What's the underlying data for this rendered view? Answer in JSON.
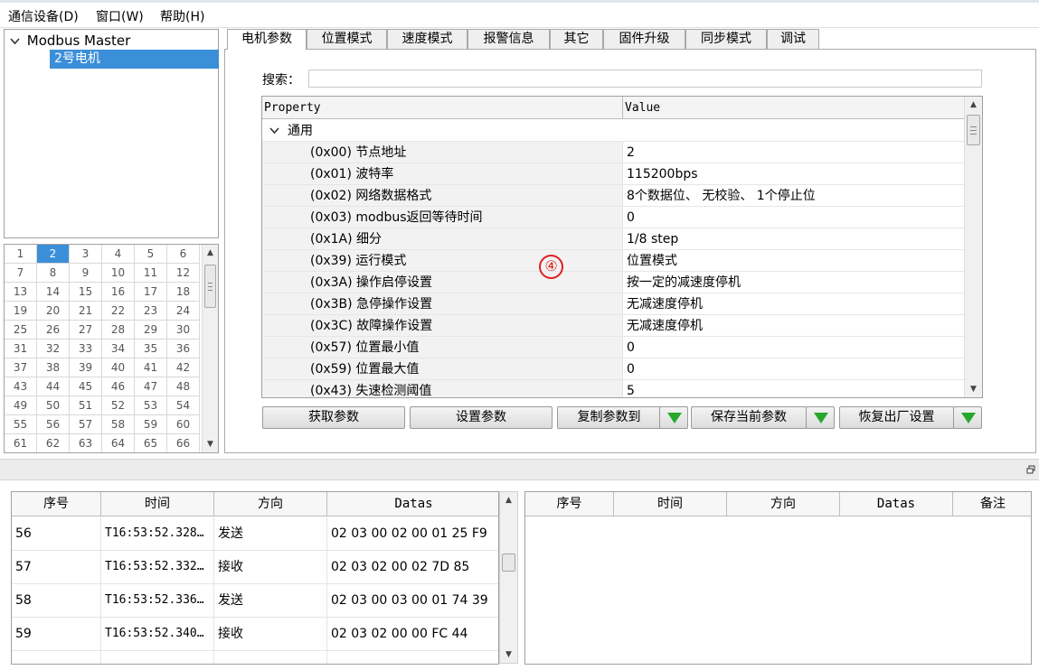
{
  "menu": [
    {
      "label": "通信设备(D)"
    },
    {
      "label": "窗口(W)"
    },
    {
      "label": "帮助(H)"
    }
  ],
  "tree": {
    "root_label": "Modbus Master",
    "child_label": "2号电机"
  },
  "grid": {
    "numbers": [
      "1",
      "2",
      "3",
      "4",
      "5",
      "6",
      "7",
      "8",
      "9",
      "10",
      "11",
      "12",
      "13",
      "14",
      "15",
      "16",
      "17",
      "18",
      "19",
      "20",
      "21",
      "22",
      "23",
      "24",
      "25",
      "26",
      "27",
      "28",
      "29",
      "30",
      "31",
      "32",
      "33",
      "34",
      "35",
      "36",
      "37",
      "38",
      "39",
      "40",
      "41",
      "42",
      "43",
      "44",
      "45",
      "46",
      "47",
      "48",
      "49",
      "50",
      "51",
      "52",
      "53",
      "54",
      "55",
      "56",
      "57",
      "58",
      "59",
      "60",
      "61",
      "62",
      "63",
      "64",
      "65",
      "66"
    ],
    "selected": "2"
  },
  "tabs": [
    "电机参数",
    "位置模式",
    "速度模式",
    "报警信息",
    "其它",
    "固件升级",
    "同步模式",
    "调试"
  ],
  "search": {
    "label": "搜索：",
    "value": ""
  },
  "props": {
    "col_property": "Property",
    "col_value": "Value",
    "group": "通用",
    "rows": [
      {
        "name": "(0x00) 节点地址",
        "value": "2"
      },
      {
        "name": "(0x01) 波特率",
        "value": "115200bps"
      },
      {
        "name": "(0x02) 网络数据格式",
        "value": "8个数据位、 无校验、 1个停止位"
      },
      {
        "name": "(0x03) modbus返回等待时间",
        "value": "0"
      },
      {
        "name": "(0x1A) 细分",
        "value": "1/8 step"
      },
      {
        "name": "(0x39) 运行模式",
        "value": "位置模式"
      },
      {
        "name": "(0x3A) 操作启停设置",
        "value": "按一定的减速度停机"
      },
      {
        "name": "(0x3B) 急停操作设置",
        "value": "无减速度停机"
      },
      {
        "name": "(0x3C) 故障操作设置",
        "value": "无减速度停机"
      },
      {
        "name": "(0x57) 位置最小值",
        "value": "0"
      },
      {
        "name": "(0x59) 位置最大值",
        "value": "0"
      },
      {
        "name": "(0x43) 失速检测阈值",
        "value": "5"
      }
    ]
  },
  "marker": "④",
  "buttons": {
    "get": "获取参数",
    "set": "设置参数",
    "copy": "复制参数到",
    "save": "保存当前参数",
    "restore": "恢复出厂设置"
  },
  "log_left": {
    "headers": [
      "序号",
      "时间",
      "方向",
      "Datas"
    ],
    "rows": [
      {
        "no": "56",
        "time": "T16:53:52.328…",
        "dir": "发送",
        "data": "02 03 00 02 00 01 25 F9"
      },
      {
        "no": "57",
        "time": "T16:53:52.332…",
        "dir": "接收",
        "data": "02 03 02 00 02 7D 85"
      },
      {
        "no": "58",
        "time": "T16:53:52.336…",
        "dir": "发送",
        "data": "02 03 00 03 00 01 74 39"
      },
      {
        "no": "59",
        "time": "T16:53:52.340…",
        "dir": "接收",
        "data": "02 03 02 00 00 FC 44"
      }
    ]
  },
  "log_right": {
    "headers": [
      "序号",
      "时间",
      "方向",
      "Datas",
      "备注"
    ]
  },
  "colors": {
    "selection": "#3b8fd9",
    "dropdown_arrow": "#27a82c",
    "marker": "#e02020"
  }
}
